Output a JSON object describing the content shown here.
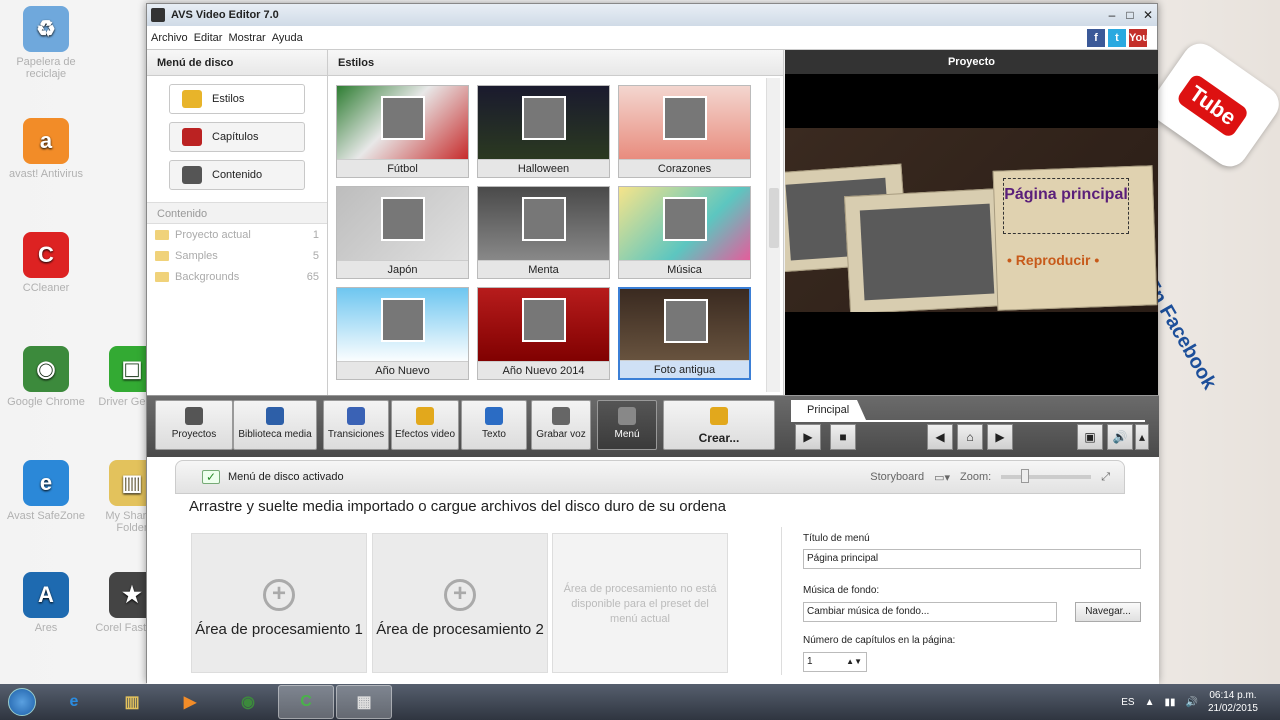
{
  "desktop": {
    "icons": [
      {
        "name": "Papelera de reciclaje",
        "color": "#6fa8dc",
        "glyph": "♻"
      },
      {
        "name": "avast! Antivirus",
        "color": "#f28c28",
        "glyph": "a"
      },
      {
        "name": "CCleaner",
        "color": "#d22",
        "glyph": "C"
      },
      {
        "name": "Google Chrome",
        "color": "#3c8a3c",
        "glyph": "◉"
      },
      {
        "name": "Avast SafeZone",
        "color": "#2b88d8",
        "glyph": "e"
      },
      {
        "name": "Ares",
        "color": "#1e6ab0",
        "glyph": "A"
      },
      {
        "name": "Driver Genius",
        "color": "#3a3",
        "glyph": "▣"
      },
      {
        "name": "My Shared Folder",
        "color": "#e3c25c",
        "glyph": "▥"
      },
      {
        "name": "Corel FastFlick",
        "color": "#444",
        "glyph": "★"
      }
    ]
  },
  "window": {
    "title": "AVS Video Editor 7.0"
  },
  "menubar": {
    "items": [
      "Archivo",
      "Editar",
      "Mostrar",
      "Ayuda"
    ]
  },
  "social": [
    {
      "label": "f",
      "color": "#3b5998"
    },
    {
      "label": "t",
      "color": "#2aa9e0"
    },
    {
      "label": "You",
      "color": "#c4302b"
    }
  ],
  "disc_menu": {
    "title": "Menú de disco",
    "buttons": [
      {
        "label": "Estilos",
        "color": "#e8b42a"
      },
      {
        "label": "Capítulos",
        "color": "#b22"
      },
      {
        "label": "Contenido",
        "color": "#555"
      }
    ],
    "content_title": "Contenido",
    "content_rows": [
      {
        "label": "Proyecto actual",
        "count": "1"
      },
      {
        "label": "Samples",
        "count": "5"
      },
      {
        "label": "Backgrounds",
        "count": "65"
      }
    ]
  },
  "styles": {
    "title": "Estilos",
    "tiles": [
      {
        "label": "Fútbol",
        "bg": "linear-gradient(135deg,#2e7d32,#e8e8e8 45%,#c62828)"
      },
      {
        "label": "Halloween",
        "bg": "linear-gradient(#1a1a2e,#2b3a20)"
      },
      {
        "label": "Corazones",
        "bg": "linear-gradient(#f3d6cf,#e88a7c)"
      },
      {
        "label": "Japón",
        "bg": "linear-gradient(135deg,#bdbdbd,#e0e0e0)"
      },
      {
        "label": "Menta",
        "bg": "linear-gradient(#4a4a4a,#8a8a8a)"
      },
      {
        "label": "Música",
        "bg": "linear-gradient(135deg,#f6e48a,#5cc6c0 60%,#e85a9a)"
      },
      {
        "label": "Año Nuevo",
        "bg": "linear-gradient(#6ec6f0,#ffffff)"
      },
      {
        "label": "Año Nuevo 2014",
        "bg": "linear-gradient(#b71c1c,#7f0000)"
      },
      {
        "label": "Foto antigua",
        "bg": "linear-gradient(#3a2a20,#6a5540)"
      }
    ],
    "selected_index": 8
  },
  "preview": {
    "title": "Proyecto",
    "menu_title": "Página principal",
    "play_label": "• Reproducir •"
  },
  "toolbar": {
    "buttons": [
      {
        "label": "Proyectos",
        "color": "#555"
      },
      {
        "label": "Biblioteca media",
        "color": "#2d5fa8"
      },
      {
        "label": "Transiciones",
        "color": "#3a62b5"
      },
      {
        "label": "Efectos video",
        "color": "#e2a81c"
      },
      {
        "label": "Texto",
        "color": "#2b6cc4"
      },
      {
        "label": "Grabar voz",
        "color": "#666"
      },
      {
        "label": "Menú",
        "color": "#888"
      },
      {
        "label": "Crear...",
        "color": "#e2a81c"
      }
    ],
    "timeline_tab": "Principal"
  },
  "lower": {
    "status": "Menú de disco activado",
    "storyboard": "Storyboard",
    "zoom_label": "Zoom:",
    "hint": "Arrastre y suelte media importado  o cargue archivos del disco duro de su ordena",
    "areas": [
      "Área de procesamiento 1",
      "Área de procesamiento 2"
    ],
    "disabled_area": "Área de procesamiento no está disponible para el preset del menú actual",
    "menu_title_label": "Título de menú",
    "menu_title_value": "Página principal",
    "music_label": "Música de fondo:",
    "music_value": "Cambiar música de fondo...",
    "browse_label": "Navegar...",
    "chapters_label": "Número de capítulos en la página:",
    "chapters_value": "1"
  },
  "taskbar": {
    "language": "ES",
    "time": "06:14 p.m.",
    "date": "21/02/2015"
  }
}
